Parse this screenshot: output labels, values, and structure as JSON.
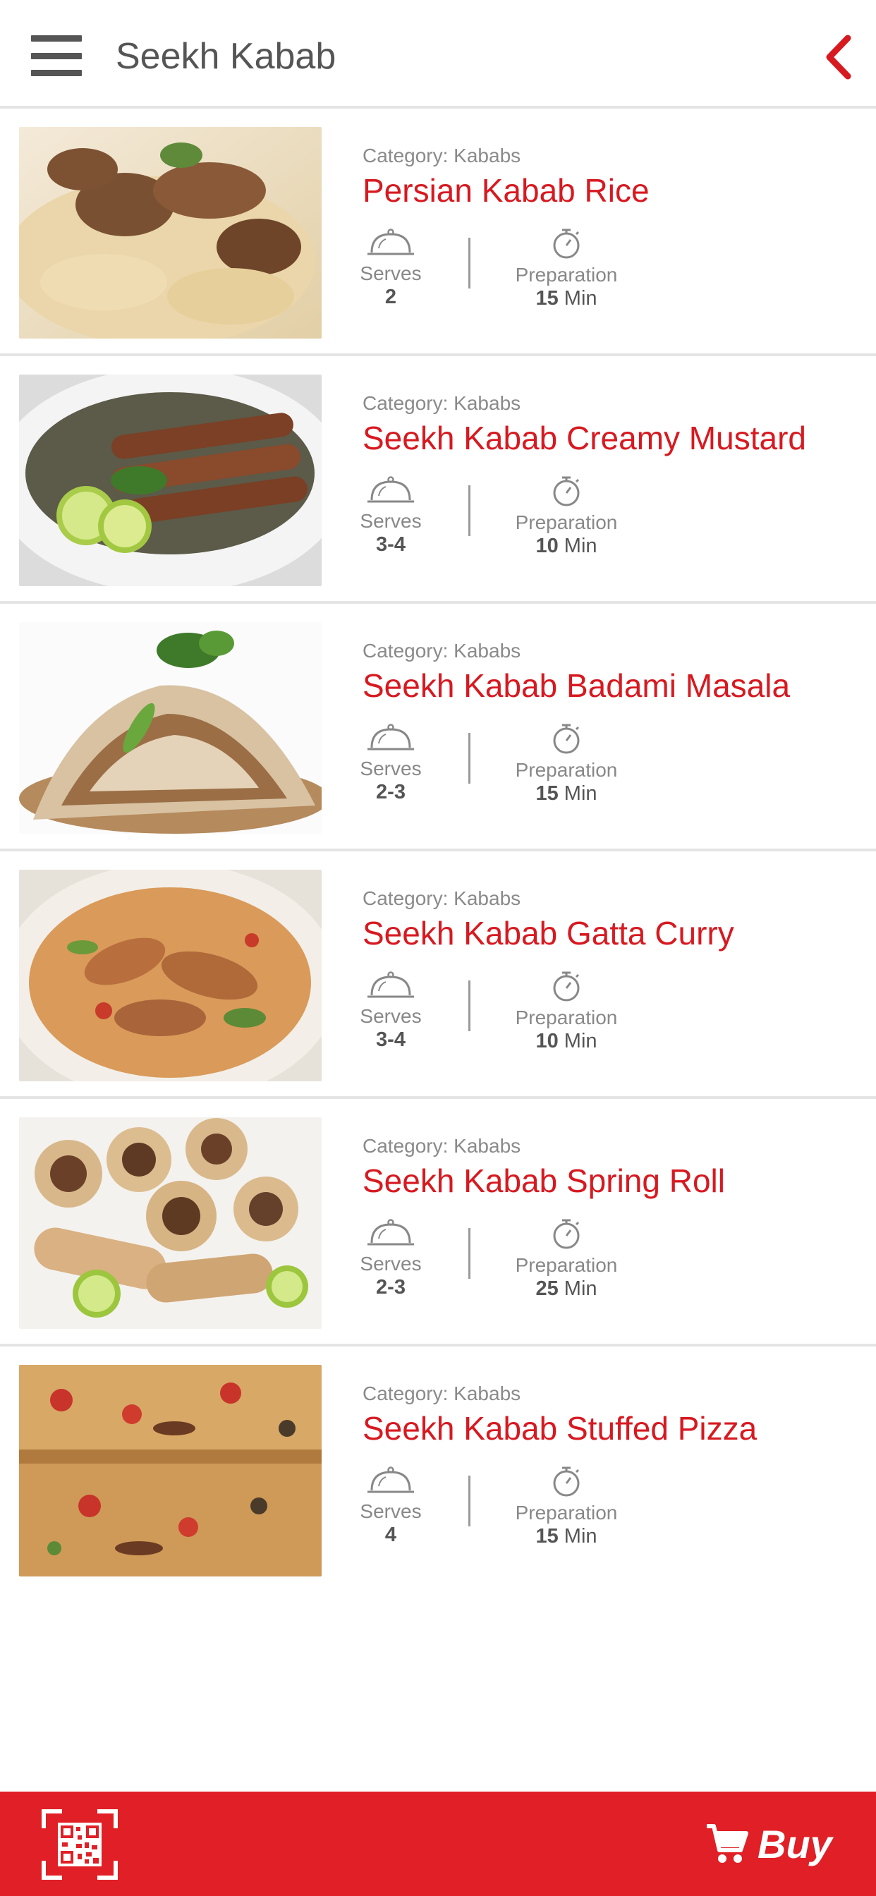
{
  "header": {
    "title": "Seekh Kabab",
    "accent_color": "#d71920"
  },
  "labels": {
    "serves": "Serves",
    "preparation": "Preparation",
    "min": "Min"
  },
  "recipes": [
    {
      "category": "Category: Kababs",
      "title": "Persian Kabab Rice",
      "serves": "2",
      "prep": "15"
    },
    {
      "category": "Category: Kababs",
      "title": "Seekh Kabab Creamy Mustard",
      "serves": "3-4",
      "prep": "10"
    },
    {
      "category": "Category: Kababs",
      "title": "Seekh Kabab Badami Masala",
      "serves": "2-3",
      "prep": "15"
    },
    {
      "category": "Category: Kababs",
      "title": "Seekh Kabab Gatta Curry",
      "serves": "3-4",
      "prep": "10"
    },
    {
      "category": "Category: Kababs",
      "title": "Seekh Kabab Spring Roll",
      "serves": "2-3",
      "prep": "25"
    },
    {
      "category": "Category: Kababs",
      "title": "Seekh Kabab Stuffed Pizza",
      "serves": "4",
      "prep": "15"
    }
  ],
  "bottom_bar": {
    "buy_label": "Buy",
    "bar_color": "#e01f26",
    "icons": [
      "qr-scan-icon",
      "cart-icon"
    ]
  }
}
